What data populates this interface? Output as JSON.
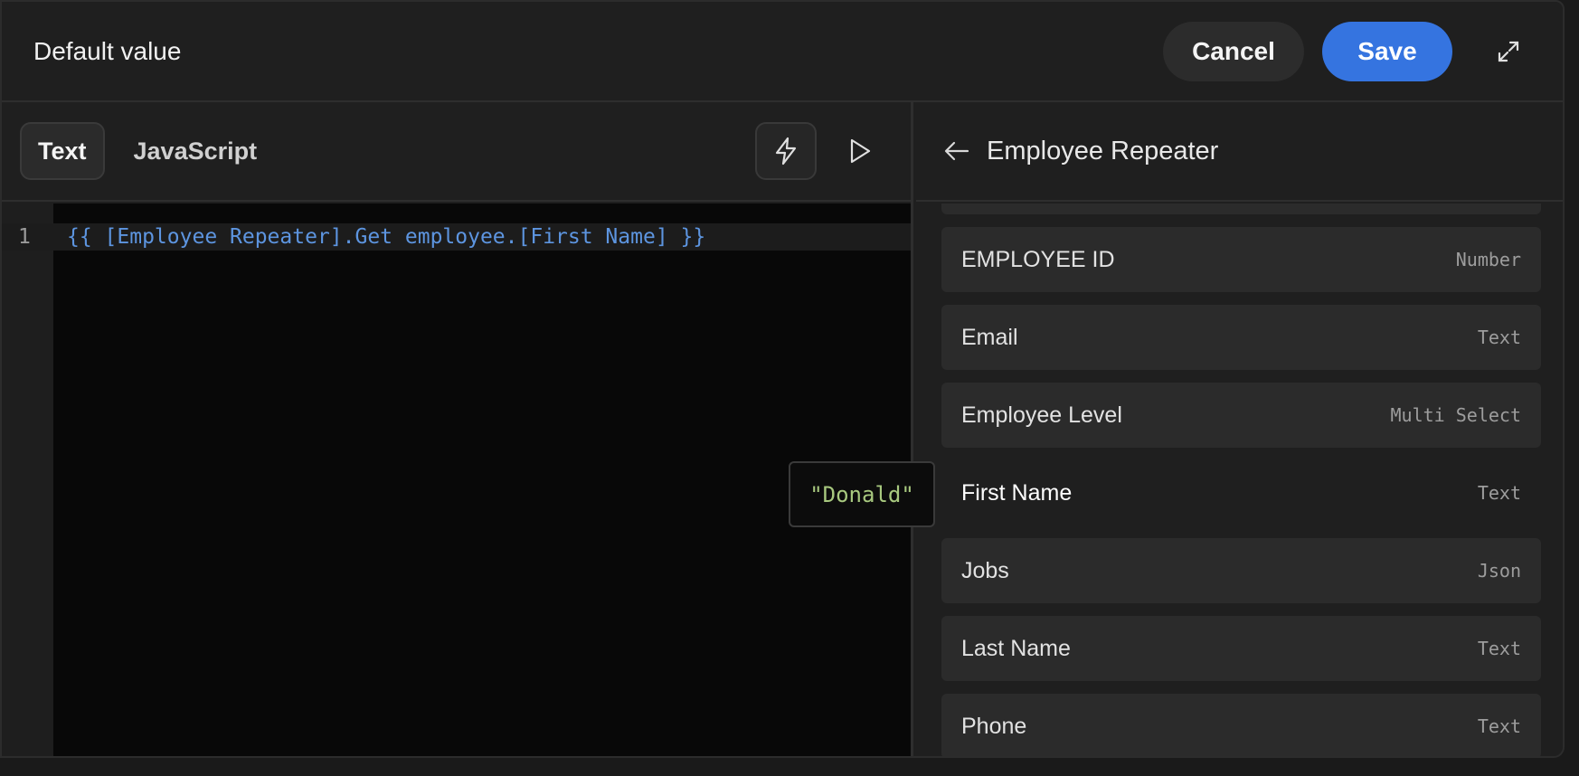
{
  "header": {
    "title": "Default value",
    "cancel_label": "Cancel",
    "save_label": "Save"
  },
  "editor": {
    "tabs": [
      {
        "label": "Text",
        "active": true
      },
      {
        "label": "JavaScript",
        "active": false
      }
    ],
    "line_number": "1",
    "code": "{{ [Employee Repeater].Get employee.[First Name] }}",
    "preview_value": "\"Donald\""
  },
  "panel": {
    "title": "Employee Repeater",
    "fields": [
      {
        "name": "EMPLOYEE ID",
        "type": "Number"
      },
      {
        "name": "Email",
        "type": "Text"
      },
      {
        "name": "Employee Level",
        "type": "Multi Select"
      },
      {
        "name": "First Name",
        "type": "Text"
      },
      {
        "name": "Jobs",
        "type": "Json"
      },
      {
        "name": "Last Name",
        "type": "Text"
      },
      {
        "name": "Phone",
        "type": "Text"
      }
    ]
  },
  "colors": {
    "accent": "#3574e0",
    "code": "#5d95e0",
    "string_value": "#a8c97f"
  }
}
